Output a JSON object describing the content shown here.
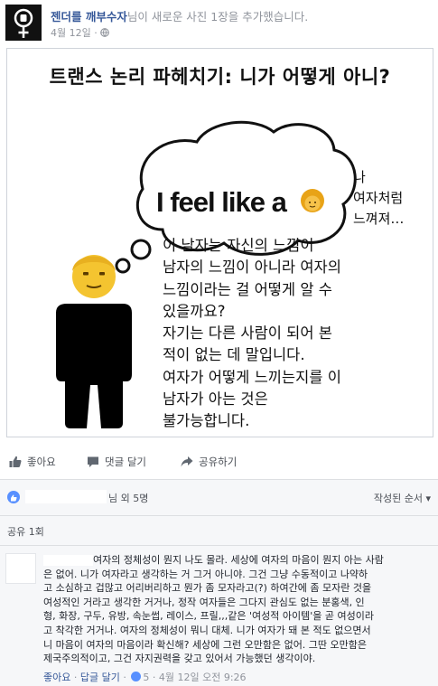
{
  "header": {
    "author": "젠더를 깨부수자",
    "action_text": "님이 새로운 사진 1장을 추가했습니다.",
    "date": "4월 12일",
    "privacy_icon": "globe-icon"
  },
  "image": {
    "title": "트랜스 논리 파헤치기: 니가 어떻게 아니?",
    "bubble_text": "I feel like a",
    "side_lines": [
      "나",
      "여자처럼",
      "느껴져…"
    ],
    "body_lines": [
      "이 남자는 자신의 느낌이",
      "남자의 느낌이 아니라 여자의",
      "느낌이라는 걸 어떻게 알 수",
      "있을까요?",
      "자기는 다른 사람이 되어 본",
      "적이 없는 데 말입니다.",
      "여자가 어떻게 느끼는지를 이",
      "남자가 아는 것은",
      "불가능합니다."
    ]
  },
  "actions": {
    "like": "좋아요",
    "comment": "댓글 달기",
    "share": "공유하기"
  },
  "reactions": {
    "likes_suffix": "님 외 5명",
    "sort": "작성된 순서"
  },
  "shares": {
    "label": "공유 1회"
  },
  "comment": {
    "lines": [
      "여자의 정체성이 뭔지 나도 몰라. 세상에 여자의 마음이 뭔지 아는 사람",
      "은 없어. 니가 여자라고 생각하는 거 그거 아니야. 그건 그냥 수동적이고 나약하",
      "고 소심하고 겁많고 어리버리하고 뭔가 좀 모자라고(?) 하여간에 좀 모자란 것을",
      "여성적인 거라고 생각한 거거나, 정작 여자들은 그다지 관심도 없는 분홍색, 인",
      "형, 화장, 구두, 유방, 속눈썹, 레이스, 프릴,,,같은 '여성적 아이템'을 곧 여성이라",
      "고 착각한 거거나. 여자의 정체성이 뭐니 대체. 니가 여자가 돼 본 적도 없으면서",
      "니 마음이 여자의 마음이라 확신해? 세상에 그런 오만함은 없어. 그딴 오만함은",
      "제국주의적이고, 그건 자지권력을 갖고 있어서 가능했던 생각이야."
    ],
    "like": "좋아요",
    "reply": "답글 달기",
    "like_count": "5",
    "timestamp": "4월 12일 오전 9:26"
  }
}
